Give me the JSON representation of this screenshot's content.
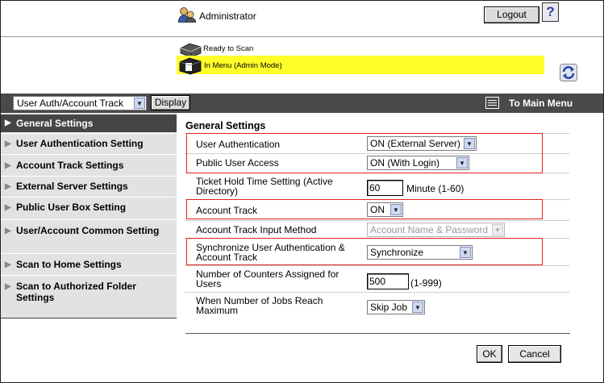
{
  "header": {
    "user": "Administrator",
    "logout_label": "Logout",
    "help_label": "?",
    "status_ready": "Ready to Scan",
    "status_menu": "In Menu (Admin Mode)",
    "refresh_icon": "refresh-icon"
  },
  "navbar": {
    "mode_select": "User Auth/Account Track",
    "display_label": "Display",
    "to_main_label": "To Main Menu"
  },
  "sidebar": {
    "items": [
      {
        "label": "General Settings",
        "active": true
      },
      {
        "label": "User Authentication Setting"
      },
      {
        "label": "Account Track Settings"
      },
      {
        "label": "External Server Settings"
      },
      {
        "label": "Public User Box Setting"
      },
      {
        "label": "User/Account Common Setting"
      },
      {
        "label": "Scan to Home Settings"
      },
      {
        "label": "Scan to Authorized Folder Settings"
      }
    ]
  },
  "content": {
    "title": "General Settings",
    "fields": {
      "user_auth": {
        "label": "User Authentication",
        "value": "ON (External Server)"
      },
      "public_access": {
        "label": "Public User Access",
        "value": "ON (With Login)"
      },
      "ticket_hold": {
        "label": "Ticket Hold Time Setting (Active Directory)",
        "value": "60",
        "unit": "Minute (1-60)"
      },
      "account_track": {
        "label": "Account Track",
        "value": "ON"
      },
      "input_method": {
        "label": "Account Track Input Method",
        "value": "Account Name & Password"
      },
      "sync": {
        "label": "Synchronize User Authentication & Account Track",
        "value": "Synchronize"
      },
      "counters": {
        "label": "Number of Counters Assigned for Users",
        "value": "500",
        "unit": "(1-999)"
      },
      "max_jobs": {
        "label": "When Number of Jobs Reach Maximum",
        "value": "Skip Job"
      }
    },
    "ok_label": "OK",
    "cancel_label": "Cancel"
  },
  "colors": {
    "status_highlight": "#ffff2a",
    "nav_bar": "#4a4a4a",
    "sidebar_bg": "#e2e2e2",
    "callout_red": "#e02020"
  }
}
